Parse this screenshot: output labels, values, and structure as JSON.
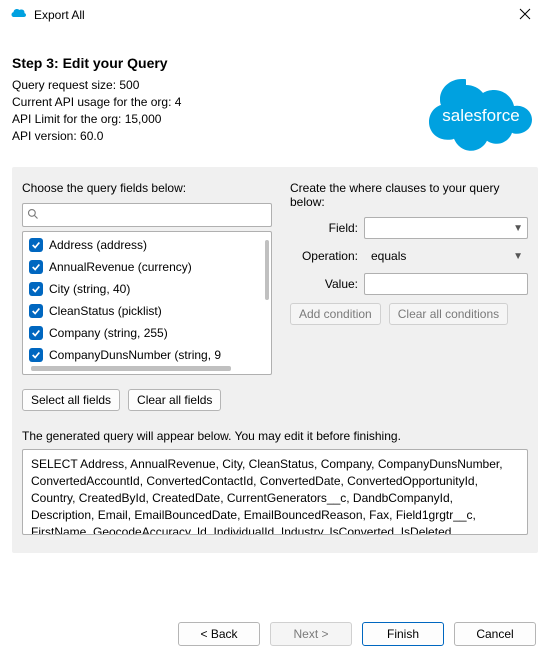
{
  "title": "Export All",
  "header": {
    "step_title": "Step 3: Edit your Query",
    "info_lines": [
      "Query request size: 500",
      "Current API usage for the org: 4",
      "API Limit for the org: 15,000",
      "API version: 60.0"
    ]
  },
  "logo_text": "salesforce",
  "left_panel": {
    "label": "Choose the query fields below:",
    "search_placeholder": "",
    "fields": [
      {
        "checked": true,
        "label": "Address (address)"
      },
      {
        "checked": true,
        "label": "AnnualRevenue (currency)"
      },
      {
        "checked": true,
        "label": "City (string, 40)"
      },
      {
        "checked": true,
        "label": "CleanStatus (picklist)"
      },
      {
        "checked": true,
        "label": "Company (string, 255)"
      },
      {
        "checked": true,
        "label": "CompanyDunsNumber (string, 9"
      }
    ],
    "select_all": "Select all fields",
    "clear_all": "Clear all fields"
  },
  "right_panel": {
    "label": "Create the where clauses to your query below:",
    "field_label": "Field:",
    "field_value": "",
    "operation_label": "Operation:",
    "operation_value": "equals",
    "value_label": "Value:",
    "value_value": "",
    "add_condition": "Add condition",
    "clear_conditions": "Clear all conditions"
  },
  "generated": {
    "label": "The generated query will appear below.  You may edit it before finishing.",
    "text": "SELECT Address, AnnualRevenue, City, CleanStatus, Company, CompanyDunsNumber, ConvertedAccountId, ConvertedContactId, ConvertedDate, ConvertedOpportunityId, Country, CreatedById, CreatedDate, CurrentGenerators__c, DandbCompanyId, Description, Email, EmailBouncedDate, EmailBouncedReason, Fax, Field1grgtr__c, FirstName, GeocodeAccuracy, Id, IndividualId, Industry, IsConverted, IsDeleted, IsPriorityRecord, IsUnreadByOwner, Jigsaw,"
  },
  "footer": {
    "back": "< Back",
    "next": "Next >",
    "finish": "Finish",
    "cancel": "Cancel"
  }
}
